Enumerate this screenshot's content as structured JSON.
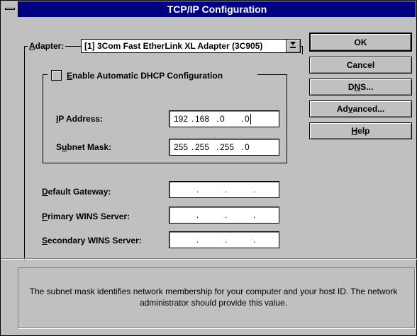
{
  "window": {
    "title": "TCP/IP Configuration"
  },
  "adapter": {
    "label_prefix": "A",
    "label_rest": "dapter:",
    "value": "[1] 3Com Fast EtherLink XL Adapter (3C905)"
  },
  "dhcp": {
    "label_prefix": "E",
    "label_rest": "nable Automatic DHCP Configuration",
    "checked": false
  },
  "ip_address": {
    "label_prefix": "I",
    "label_rest": "P Address:",
    "octets": [
      "192",
      "168",
      "0",
      "0"
    ]
  },
  "subnet_mask": {
    "label_pre": "S",
    "label_ul": "u",
    "label_rest": "bnet Mask:",
    "octets": [
      "255",
      "255",
      "255",
      "0"
    ]
  },
  "default_gateway": {
    "label_prefix": "D",
    "label_rest": "efault Gateway:",
    "octets": [
      "",
      "",
      "",
      ""
    ]
  },
  "primary_wins": {
    "label_prefix": "P",
    "label_rest": "rimary WINS Server:",
    "octets": [
      "",
      "",
      "",
      ""
    ]
  },
  "secondary_wins": {
    "label_prefix": "S",
    "label_rest": "econdary WINS Server:",
    "octets": [
      "",
      "",
      "",
      ""
    ]
  },
  "buttons": {
    "ok": "OK",
    "cancel": "Cancel",
    "dns_pre": "D",
    "dns_ul": "N",
    "dns_rest": "S...",
    "advanced_pre": "Ad",
    "advanced_ul": "v",
    "advanced_rest": "anced...",
    "help_ul": "H",
    "help_rest": "elp"
  },
  "status": {
    "message": "The subnet mask identifies network membership for your computer and your host ID. The network administrator should provide this value."
  },
  "colors": {
    "titlebar": "#000080",
    "face": "#c0c0c0"
  }
}
